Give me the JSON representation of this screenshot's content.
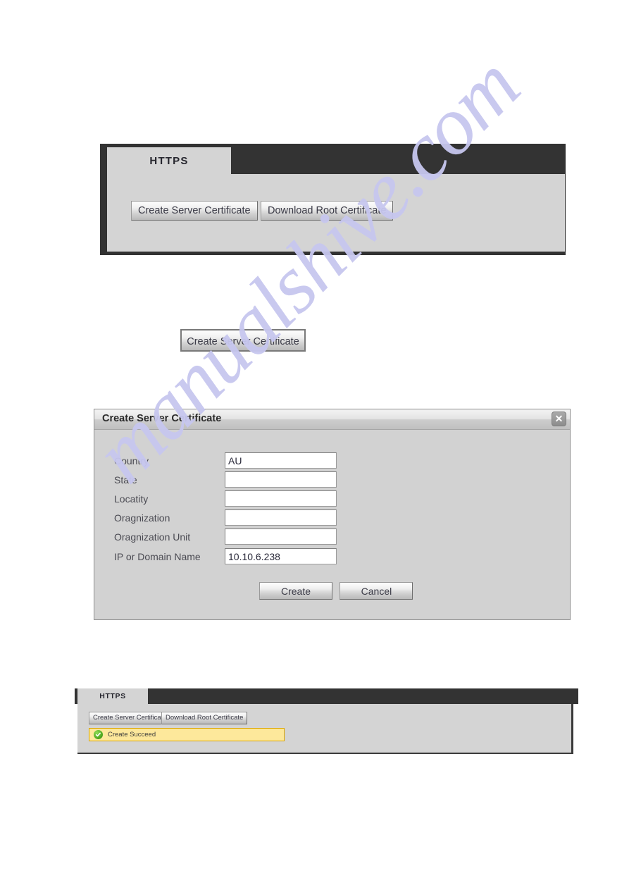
{
  "watermark": {
    "text": "manualshive.com",
    "color": "#c7c7ef"
  },
  "top_panel": {
    "tab_label": "HTTPS",
    "buttons": {
      "create_server_certificate": "Create Server Certificate",
      "download_root_certificate": "Download Root Certificate"
    }
  },
  "standalone_button": {
    "label": "Create Server Certificate"
  },
  "dialog": {
    "title": "Create Server Certificate",
    "close_icon": "close-icon",
    "close_glyph": "✕",
    "fields": [
      {
        "label": "Country",
        "value": "AU",
        "placeholder": ""
      },
      {
        "label": "State",
        "value": "",
        "placeholder": ""
      },
      {
        "label": "Locatity",
        "value": "",
        "placeholder": ""
      },
      {
        "label": "Oragnization",
        "value": "",
        "placeholder": ""
      },
      {
        "label": "Oragnization Unit",
        "value": "",
        "placeholder": ""
      },
      {
        "label": "IP or Domain Name",
        "value": "10.10.6.238",
        "placeholder": ""
      }
    ],
    "create_label": "Create",
    "cancel_label": "Cancel"
  },
  "bottom_panel": {
    "tab_label": "HTTPS",
    "buttons": {
      "create_server_certificate": "Create Server Certificate",
      "download_root_certificate": "Download Root Certificate"
    },
    "notice": {
      "icon": "success-check-icon",
      "text": "Create Succeed",
      "background": "#fde89b",
      "border": "#d9a400",
      "icon_color": "#49a21a"
    }
  }
}
